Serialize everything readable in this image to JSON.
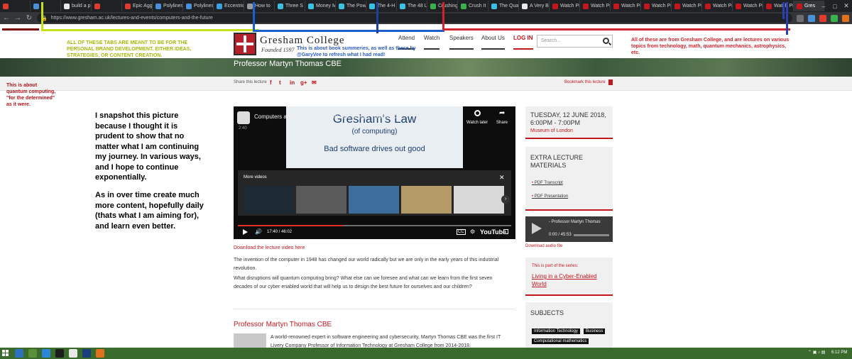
{
  "browser": {
    "tabs": [
      {
        "label": "",
        "color": "#e03b2f"
      },
      {
        "label": "",
        "color": "#4a90d9"
      },
      {
        "label": "build a p",
        "color": "#e8e8e8"
      },
      {
        "label": "",
        "color": "#e03b2f"
      },
      {
        "label": "Epic Agg",
        "color": "#e03b2f"
      },
      {
        "label": "Polylines",
        "color": "#4a90d9"
      },
      {
        "label": "Polylines",
        "color": "#4a90d9"
      },
      {
        "label": "Eccentric",
        "color": "#3aa0e0"
      },
      {
        "label": "How to ",
        "color": "#9a9a9a"
      },
      {
        "label": "Three S",
        "color": "#3ac0e0"
      },
      {
        "label": "Money M",
        "color": "#3ac0e0"
      },
      {
        "label": "The Pow",
        "color": "#3ac0e0"
      },
      {
        "label": "The 4-H",
        "color": "#3ac0e0"
      },
      {
        "label": "The 48 L",
        "color": "#3ac0e0"
      },
      {
        "label": "Crushing",
        "color": "#38b24a"
      },
      {
        "label": "Crush It",
        "color": "#38b24a"
      },
      {
        "label": "The Qua",
        "color": "#3ac0e0"
      },
      {
        "label": "A Very Bi",
        "color": "#e8e8e8"
      },
      {
        "label": "Watch Pr",
        "color": "#c3171e"
      },
      {
        "label": "Watch Pr",
        "color": "#c3171e"
      },
      {
        "label": "Watch Pr",
        "color": "#c3171e"
      },
      {
        "label": "Watch Pr",
        "color": "#c3171e"
      },
      {
        "label": "Watch Pr",
        "color": "#c3171e"
      },
      {
        "label": "Watch Pr",
        "color": "#c3171e"
      },
      {
        "label": "Watch Pr",
        "color": "#c3171e"
      },
      {
        "label": "Watch Pr",
        "color": "#c3171e"
      },
      {
        "label": "Gres",
        "color": "#c3171e"
      }
    ],
    "url": "https://www.gresham.ac.uk/lectures-and-events/computers-and-the-future"
  },
  "site": {
    "name": "Gresham College",
    "founded": "Founded 1597",
    "nav": [
      "Attend",
      "Watch",
      "Speakers",
      "About Us",
      "LOG IN"
    ],
    "search_placeholder": "Search...",
    "banner_title": "Professor Martyn Thomas CBE",
    "share_label": "Share this lecture",
    "share_icons": [
      "f",
      "t",
      "in",
      "g+",
      "✉"
    ],
    "bookmark_label": "Bookmark this lecture"
  },
  "video": {
    "title": "Computers and the Future - Professor Martyn Thomas CBE",
    "small_time": "2:40",
    "slide_title": "Gresham's Law",
    "slide_subtitle": "(of computing)",
    "slide_tagline": "Bad software drives out good",
    "watch_later": "Watch later",
    "share": "Share",
    "more_videos": "More videos",
    "time": "17:40 / 46:02",
    "progress_fraction": 0.384,
    "youtube": "YouTube",
    "thumb_colors": [
      "#1e2a33",
      "#5a5a5a",
      "#3d6e9c",
      "#b49a67",
      "#d8d8d8"
    ]
  },
  "content": {
    "download_link": "Download the lecture video here",
    "paragraph1": "The invention of the computer in 1948 has changed our world radically but we are only in the early years of this industrial revolution.",
    "paragraph2": "What disruptions will quantum computing bring? What else can we foresee and what can we learn from the first seven decades of our cyber enabled world that will help us to design the best future for ourselves and our children?",
    "speaker_heading": "Professor Martyn Thomas CBE",
    "speaker_bio": "A world-renowned expert in software engineering and cybersecurity, Martyn Thomas CBE was the first IT Livery Company Professor of Information Technology at Gresham College from 2014-2018."
  },
  "sidebar": {
    "date": "TUESDAY, 12 JUNE 2018, 6:00PM - 7:00PM",
    "venue": "Museum of London",
    "extra_heading": "EXTRA LECTURE MATERIALS",
    "links": [
      "PDF Transcript",
      "PDF Presentation"
    ],
    "audio_title": "- Professor Martyn Thomas",
    "audio_time": "0:00 / 45:53",
    "audio_download": "Download audio file",
    "series_label": "This is part of the series:",
    "series_link": "Living in a Cyber-Enabled World",
    "subjects_heading": "SUBJECTS",
    "subject_tags": [
      "Information Technology",
      "Business",
      "Computational mathematics"
    ]
  },
  "annotations": {
    "personal": "ALL OF THESE TABS ARE MEANT TO BE FOR THE PERSONAL BRAND DEVELOPMENT. EITHER IDEAS, STRATEGIES, OR CONTENT CREATION.",
    "book": "This is about book summeries, as well as these by @GaryVee to refresh what I had read!",
    "gresham": "All of these are from Gresham College, and are lectures on various topics from technology, math, quantum mechanics, astrophysics, etc.",
    "quantum": "This is about quantum computing, \"for the determined\" as it were.",
    "journey": "I snapshot this picture because I thought it is prudent to show that no matter what I am continuing my journey. In various ways, and I hope to continue exponentially.",
    "content": "As in over time create much more content, hopefully daily (thats what I am aiming for), and learn even better."
  },
  "taskbar": {
    "clock": "6:12 PM",
    "app_colors": [
      "#2f6fc0",
      "#5a8f3b",
      "#2b88d8",
      "#1d1d1d",
      "#e8e8e8",
      "#1a3e7a",
      "#e0721e"
    ]
  }
}
